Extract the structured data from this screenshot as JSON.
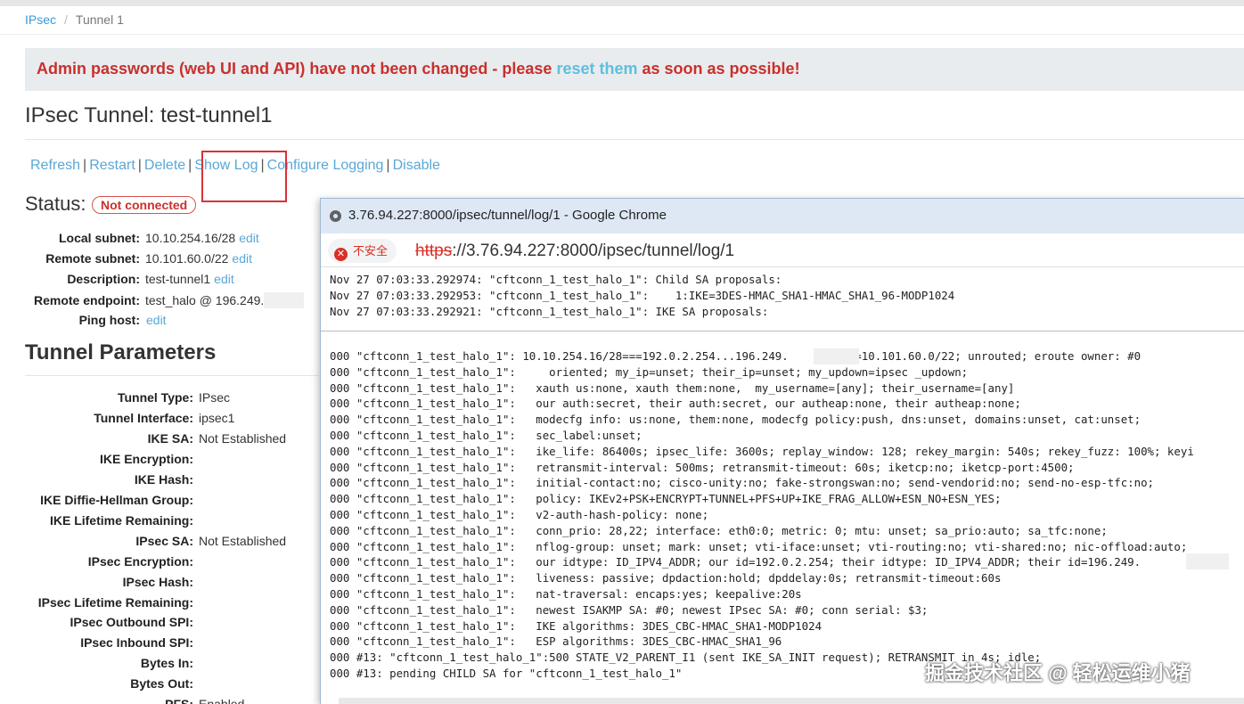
{
  "breadcrumb": {
    "root": "IPsec",
    "current": "Tunnel 1"
  },
  "alert": {
    "pre": "Admin passwords (web UI and API) have not been changed - please ",
    "link": "reset them",
    "post": " as soon as possible!"
  },
  "page_title": "IPsec Tunnel: test-tunnel1",
  "actions": {
    "refresh": "Refresh",
    "restart": "Restart",
    "delete": "Delete",
    "show_log": "Show Log",
    "configure_logging": "Configure Logging",
    "disable": "Disable",
    "separator": "|"
  },
  "status": {
    "label": "Status:",
    "badge": "Not connected"
  },
  "info": {
    "local_subnet": {
      "label": "Local subnet:",
      "value": "10.10.254.16/28",
      "edit": "edit"
    },
    "remote_subnet": {
      "label": "Remote subnet:",
      "value": "10.101.60.0/22",
      "edit": "edit"
    },
    "description": {
      "label": "Description:",
      "value": "test-tunnel1",
      "edit": "edit"
    },
    "remote_endpoint": {
      "label": "Remote endpoint:",
      "value": "test_halo @ 196.249."
    },
    "ping_host": {
      "label": "Ping host:",
      "edit": "edit"
    }
  },
  "params_title": "Tunnel Parameters",
  "params": [
    {
      "label": "Tunnel Type:",
      "value": "IPsec"
    },
    {
      "label": "Tunnel Interface:",
      "value": "ipsec1"
    },
    {
      "label": "IKE SA:",
      "value": "Not Established"
    },
    {
      "label": "IKE Encryption:",
      "value": ""
    },
    {
      "label": "IKE Hash:",
      "value": ""
    },
    {
      "label": "IKE Diffie-Hellman Group:",
      "value": ""
    },
    {
      "label": "IKE Lifetime Remaining:",
      "value": ""
    },
    {
      "label": "IPsec SA:",
      "value": "Not Established"
    },
    {
      "label": "IPsec Encryption:",
      "value": ""
    },
    {
      "label": "IPsec Hash:",
      "value": ""
    },
    {
      "label": "IPsec Lifetime Remaining:",
      "value": ""
    },
    {
      "label": "IPsec Outbound SPI:",
      "value": ""
    },
    {
      "label": "IPsec Inbound SPI:",
      "value": ""
    },
    {
      "label": "Bytes In:",
      "value": ""
    },
    {
      "label": "Bytes Out:",
      "value": ""
    },
    {
      "label": "PFS:",
      "value": "Enabled"
    }
  ],
  "popup": {
    "title": "3.76.94.227:8000/ipsec/tunnel/log/1 - Google Chrome",
    "insecure_label": "不安全",
    "url_proto": "https",
    "url_rest": "://3.76.94.227:8000/ipsec/tunnel/log/1",
    "log_top": [
      "Nov 27 07:03:33.292974: \"cftconn_1_test_halo_1\": Child SA proposals:",
      "Nov 27 07:03:33.292953: \"cftconn_1_test_halo_1\":    1:IKE=3DES-HMAC_SHA1-HMAC_SHA1_96-MODP1024",
      "Nov 27 07:03:33.292921: \"cftconn_1_test_halo_1\": IKE SA proposals:"
    ],
    "log_main": [
      "000 \"cftconn_1_test_halo_1\": 10.10.254.16/28===192.0.2.254...196.249.        ===10.101.60.0/22; unrouted; eroute owner: #0",
      "000 \"cftconn_1_test_halo_1\":     oriented; my_ip=unset; their_ip=unset; my_updown=ipsec _updown;",
      "000 \"cftconn_1_test_halo_1\":   xauth us:none, xauth them:none,  my_username=[any]; their_username=[any]",
      "000 \"cftconn_1_test_halo_1\":   our auth:secret, their auth:secret, our autheap:none, their autheap:none;",
      "000 \"cftconn_1_test_halo_1\":   modecfg info: us:none, them:none, modecfg policy:push, dns:unset, domains:unset, cat:unset;",
      "000 \"cftconn_1_test_halo_1\":   sec_label:unset;",
      "000 \"cftconn_1_test_halo_1\":   ike_life: 86400s; ipsec_life: 3600s; replay_window: 128; rekey_margin: 540s; rekey_fuzz: 100%; keyi",
      "000 \"cftconn_1_test_halo_1\":   retransmit-interval: 500ms; retransmit-timeout: 60s; iketcp:no; iketcp-port:4500;",
      "000 \"cftconn_1_test_halo_1\":   initial-contact:no; cisco-unity:no; fake-strongswan:no; send-vendorid:no; send-no-esp-tfc:no;",
      "000 \"cftconn_1_test_halo_1\":   policy: IKEv2+PSK+ENCRYPT+TUNNEL+PFS+UP+IKE_FRAG_ALLOW+ESN_NO+ESN_YES;",
      "000 \"cftconn_1_test_halo_1\":   v2-auth-hash-policy: none;",
      "000 \"cftconn_1_test_halo_1\":   conn_prio: 28,22; interface: eth0:0; metric: 0; mtu: unset; sa_prio:auto; sa_tfc:none;",
      "000 \"cftconn_1_test_halo_1\":   nflog-group: unset; mark: unset; vti-iface:unset; vti-routing:no; vti-shared:no; nic-offload:auto;",
      "000 \"cftconn_1_test_halo_1\":   our idtype: ID_IPV4_ADDR; our id=192.0.2.254; their idtype: ID_IPV4_ADDR; their id=196.249.",
      "000 \"cftconn_1_test_halo_1\":   liveness: passive; dpdaction:hold; dpddelay:0s; retransmit-timeout:60s",
      "000 \"cftconn_1_test_halo_1\":   nat-traversal: encaps:yes; keepalive:20s",
      "000 \"cftconn_1_test_halo_1\":   newest ISAKMP SA: #0; newest IPsec SA: #0; conn serial: $3;",
      "000 \"cftconn_1_test_halo_1\":   IKE algorithms: 3DES_CBC-HMAC_SHA1-MODP1024",
      "000 \"cftconn_1_test_halo_1\":   ESP algorithms: 3DES_CBC-HMAC_SHA1_96",
      "000 #13: \"cftconn_1_test_halo_1\":500 STATE_V2_PARENT_I1 (sent IKE_SA_INIT request); RETRANSMIT in 4s; idle;",
      "000 #13: pending CHILD SA for \"cftconn_1_test_halo_1\""
    ]
  },
  "watermark": "掘金技术社区 @ 轻松运维小猪"
}
